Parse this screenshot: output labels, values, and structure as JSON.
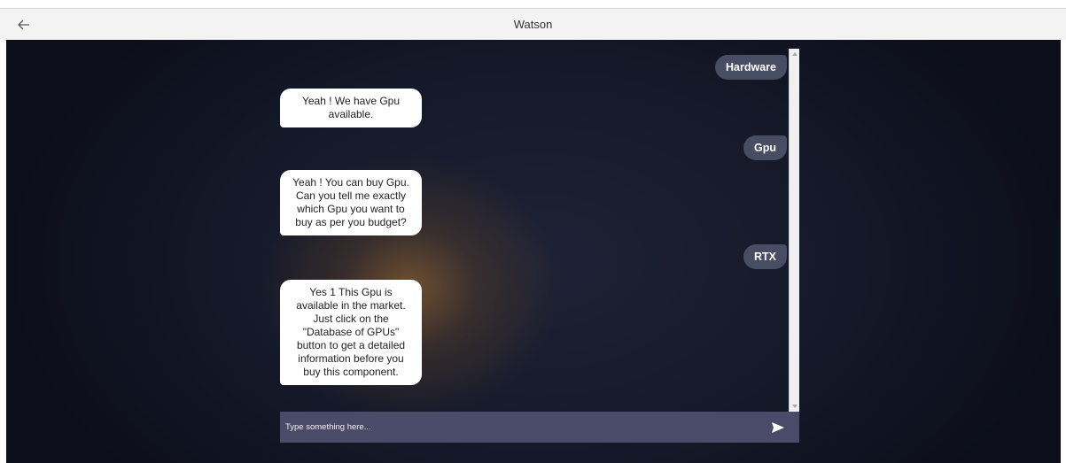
{
  "header": {
    "title": "Watson",
    "back_icon": "arrow-left-icon"
  },
  "chat": {
    "messages": [
      {
        "from": "user",
        "text": "Hardware"
      },
      {
        "from": "bot",
        "lines": [
          "Yeah ! We have Gpu",
          "available."
        ]
      },
      {
        "from": "user",
        "text": "Gpu"
      },
      {
        "from": "bot",
        "lines": [
          "Yeah ! You can buy Gpu.",
          "Can you tell me exactly",
          "which Gpu you want to",
          "buy as per you budget?"
        ]
      },
      {
        "from": "user",
        "text": "RTX"
      },
      {
        "from": "bot",
        "lines": [
          "Yes 1 This Gpu is",
          "available in the market.",
          "Just click on the",
          "\"Database of GPUs\"",
          "button to get a detailed",
          "information before you",
          "buy this component."
        ]
      }
    ]
  },
  "input": {
    "placeholder": "Type something here...",
    "value": "",
    "send_icon": "send-icon"
  },
  "colors": {
    "user_bubble": "#474d63",
    "bot_bubble": "#ffffff",
    "input_bar": "#4a4b69"
  }
}
